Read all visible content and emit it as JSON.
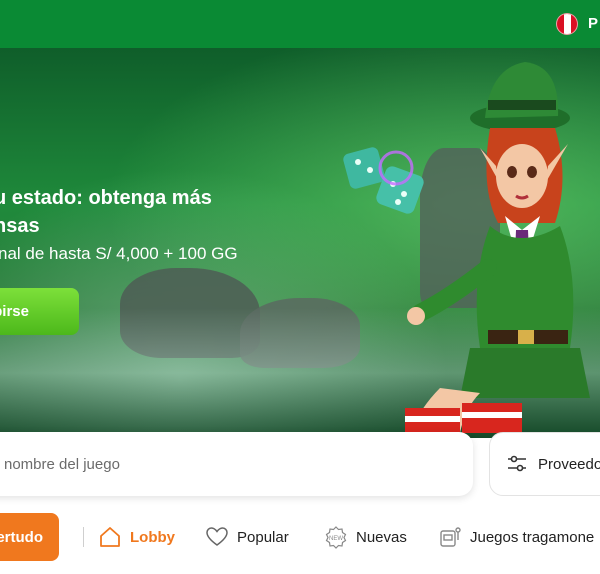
{
  "header": {
    "language_code": "P"
  },
  "hero": {
    "title": "u estado: obtenga más\nnsas",
    "title_line1": "u estado: obtenga más",
    "title_line2": "nsas",
    "subtitle": "nal de hasta S/ 4,000 + 100 GG",
    "cta_label": "birse"
  },
  "search": {
    "placeholder": "nombre del juego"
  },
  "providers": {
    "label": "Proveedo"
  },
  "categories": {
    "open_label": "ertudo",
    "tabs": [
      {
        "label": "Lobby",
        "icon": "home-icon",
        "active": true
      },
      {
        "label": "Popular",
        "icon": "heart-icon",
        "active": false
      },
      {
        "label": "Nuevas",
        "icon": "new-badge-icon",
        "active": false
      },
      {
        "label": "Juegos tragamone",
        "icon": "slot-machine-icon",
        "active": false
      }
    ]
  },
  "colors": {
    "topbar": "#0a8a34",
    "accent_orange": "#f0781e",
    "cta_green": "#5cc924"
  }
}
